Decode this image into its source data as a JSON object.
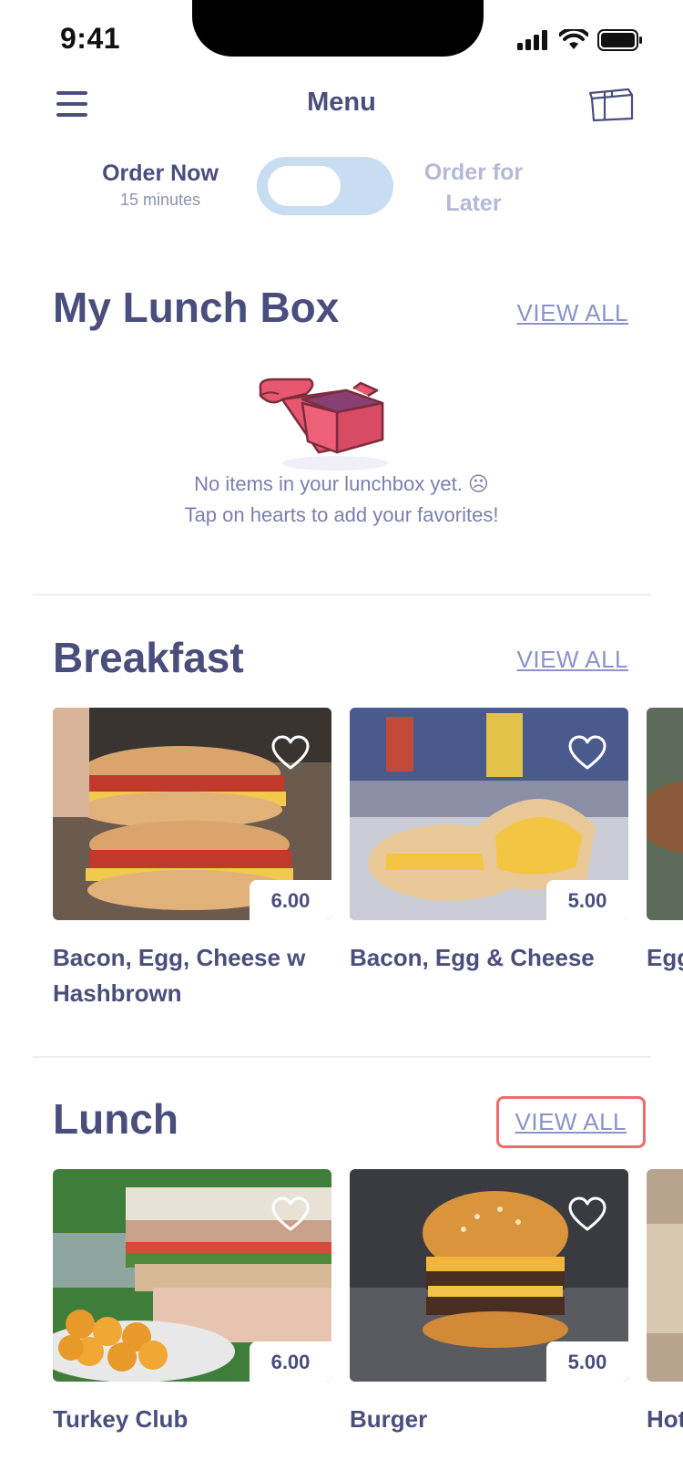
{
  "status": {
    "time": "9:41"
  },
  "nav": {
    "title": "Menu"
  },
  "order_toggle": {
    "now_label": "Order Now",
    "now_sub": "15 minutes",
    "later_label": "Order for Later"
  },
  "lunchbox": {
    "title": "My Lunch Box",
    "view_all": "VIEW ALL",
    "empty_line1": "No items in your lunchbox yet. ☹",
    "empty_line2": "Tap on hearts to add your favorites!"
  },
  "breakfast": {
    "title": "Breakfast",
    "view_all": "VIEW ALL",
    "items": [
      {
        "name": "Bacon, Egg, Cheese w Hashbrown",
        "price": "6.00"
      },
      {
        "name": "Bacon, Egg & Cheese",
        "price": "5.00"
      },
      {
        "name": "Egg",
        "price": ""
      }
    ]
  },
  "lunch": {
    "title": "Lunch",
    "view_all": "VIEW ALL",
    "items": [
      {
        "name": "Turkey Club",
        "price": "6.00"
      },
      {
        "name": "Burger",
        "price": "5.00"
      },
      {
        "name": "Hot",
        "price": ""
      }
    ]
  },
  "colors": {
    "primary_text": "#4a4e7d",
    "link": "#8b93c9",
    "toggle_bg": "#c8dcf2",
    "highlight": "#ef6b6b"
  }
}
